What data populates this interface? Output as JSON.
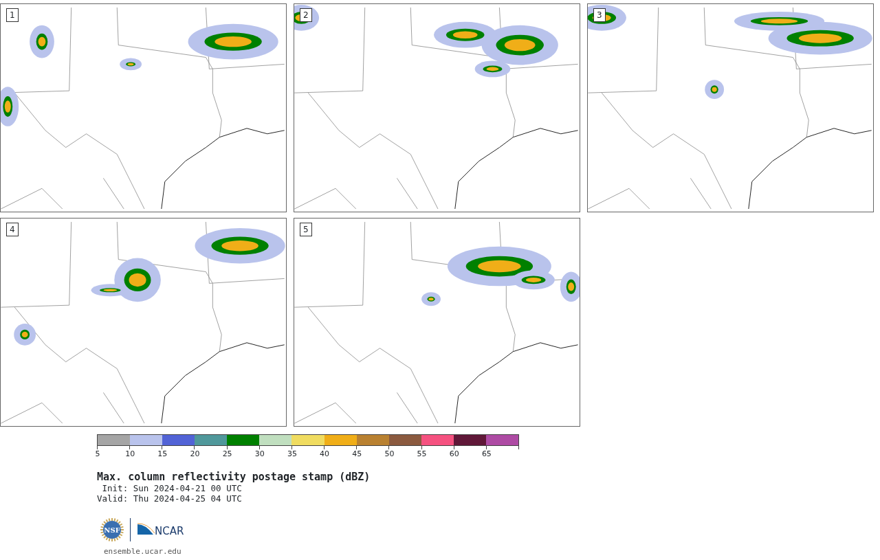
{
  "panels": [
    {
      "number": "1"
    },
    {
      "number": "2"
    },
    {
      "number": "3"
    },
    {
      "number": "4"
    },
    {
      "number": "5"
    }
  ],
  "colorbar": {
    "bins": [
      {
        "color": "#a5a5a5"
      },
      {
        "color": "#b9c3ec"
      },
      {
        "color": "#5263d6"
      },
      {
        "color": "#50989b"
      },
      {
        "color": "#008000"
      },
      {
        "color": "#c0dfbf"
      },
      {
        "color": "#f0dc60"
      },
      {
        "color": "#f0ae18"
      },
      {
        "color": "#b98131"
      },
      {
        "color": "#8b5a3f"
      },
      {
        "color": "#f55280"
      },
      {
        "color": "#601838"
      },
      {
        "color": "#ae4ba4"
      }
    ],
    "ticks": [
      "5",
      "10",
      "15",
      "20",
      "25",
      "30",
      "35",
      "40",
      "45",
      "50",
      "55",
      "60",
      "65"
    ]
  },
  "title": "Max. column reflectivity postage stamp (dBZ)",
  "init": " Init: Sun 2024-04-21 00 UTC",
  "valid": "Valid: Thu 2024-04-25 04 UTC",
  "logo": {
    "seal_text": "NSF",
    "wordmark": "NCAR"
  },
  "website": "ensemble.ucar.edu"
}
